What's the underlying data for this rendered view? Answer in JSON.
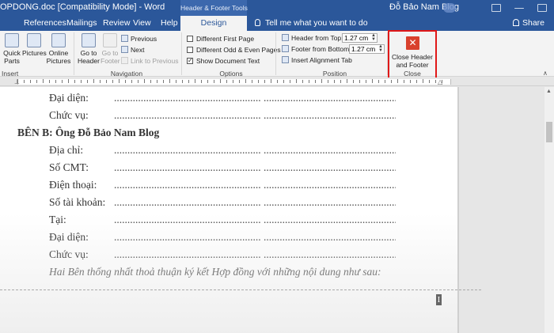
{
  "titlebar": {
    "doc_title": "OPDONG.doc [Compatibility Mode] - Word",
    "contextual_tools": "Header & Footer Tools",
    "user_name": "Đỗ Bảo Nam Blog"
  },
  "tabs": [
    {
      "label": "References"
    },
    {
      "label": "Mailings"
    },
    {
      "label": "Review"
    },
    {
      "label": "View"
    },
    {
      "label": "Help"
    },
    {
      "label": "Design"
    }
  ],
  "tell_me": "Tell me what you want to do",
  "share": "Share",
  "ribbon": {
    "insert": {
      "quick_parts": "Quick Parts",
      "pictures": "Pictures",
      "online_pictures": "Online Pictures",
      "group_label": "Insert"
    },
    "navigation": {
      "go_to_header": "Go to Header",
      "go_to_footer": "Go to Footer",
      "previous": "Previous",
      "next": "Next",
      "link_to_previous": "Link to Previous",
      "group_label": "Navigation"
    },
    "options": {
      "different_first_page": "Different First Page",
      "different_odd_even": "Different Odd & Even Pages",
      "show_document_text": "Show Document Text",
      "show_document_text_checked": true,
      "group_label": "Options"
    },
    "position": {
      "header_from_top_label": "Header from Top:",
      "header_from_top_value": "1.27 cm",
      "footer_from_bottom_label": "Footer from Bottom:",
      "footer_from_bottom_value": "1.27 cm",
      "insert_alignment_tab": "Insert Alignment Tab",
      "group_label": "Position"
    },
    "close": {
      "close_header_footer": "Close Header and Footer",
      "group_label": "Close"
    }
  },
  "document": {
    "lines": [
      {
        "label": "Đại diện:"
      },
      {
        "label": "Chức vụ:"
      },
      {
        "label": "BÊN B: Ông Đỗ Bảo Nam Blog"
      },
      {
        "label": "Địa chỉ:"
      },
      {
        "label": "Số CMT:"
      },
      {
        "label": "Điện thoại:"
      },
      {
        "label": "Số tài khoản:"
      },
      {
        "label": "Tại:"
      },
      {
        "label": "Đại diện:"
      },
      {
        "label": "Chức vụ:"
      },
      {
        "label": "Hai Bên thống nhất thoả thuận ký kết  Hợp đồng với những nội dung như sau:"
      }
    ],
    "dot_leader": ".......................................................  .......................................................",
    "cursor_glyph": "I"
  },
  "colors": {
    "title_bar": "#2b579a",
    "ribbon": "#f3f3f3",
    "highlight_box": "#e01818",
    "close_icon": "#d9412d"
  }
}
